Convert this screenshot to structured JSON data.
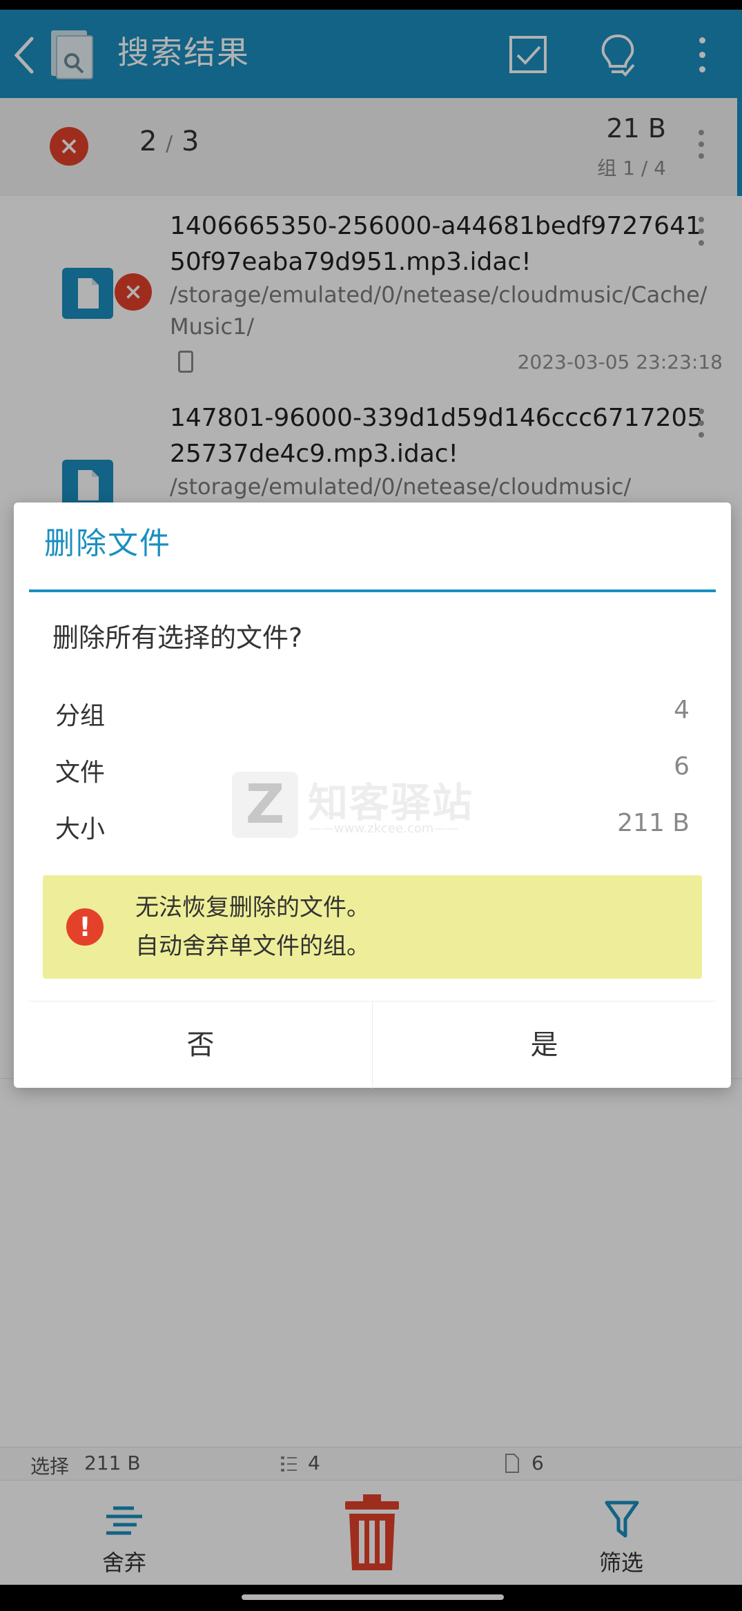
{
  "appbar": {
    "title": "搜索结果",
    "icons": [
      "back-icon",
      "app-icon",
      "select-all-icon",
      "tips-bulb-icon",
      "overflow-menu-icon"
    ]
  },
  "group": {
    "counter_current": "2",
    "counter_sep": "/",
    "counter_total": "3",
    "size": "21 B",
    "index": "组 1 / 4"
  },
  "files": [
    {
      "name": "1406665350-256000-a44681bedf972764150f97eaba79d951.mp3.idac!",
      "path": "/storage/emulated/0/netease/cloudmusic/Cache/Music1/",
      "date": "2023-03-05 23:23:18"
    },
    {
      "name": "147801-96000-339d1d59d146ccc671720525737de4c9.mp3.idac!",
      "path": "/storage/emulated/0/netease/cloudmusic/"
    }
  ],
  "dialog": {
    "title": "删除文件",
    "question": "删除所有选择的文件?",
    "stats": [
      {
        "label": "分组",
        "value": "4"
      },
      {
        "label": "文件",
        "value": "6"
      },
      {
        "label": "大小",
        "value": "211 B"
      }
    ],
    "warning_line1": "无法恢复删除的文件。",
    "warning_line2": "自动舍弃单文件的组。",
    "no_label": "否",
    "yes_label": "是"
  },
  "statsbar": {
    "selected_label": "选择",
    "selected_size": "211 B",
    "groups_count": "4",
    "files_count": "6"
  },
  "bottombar": {
    "discard_label": "舍弃",
    "filter_label": "筛选"
  },
  "watermark": {
    "brand": "知客驿站",
    "url": "——www.zkcee.com——"
  },
  "colors": {
    "accent": "#1a8fbf",
    "danger": "#e4412b",
    "warning_bg": "#eeee9a"
  }
}
